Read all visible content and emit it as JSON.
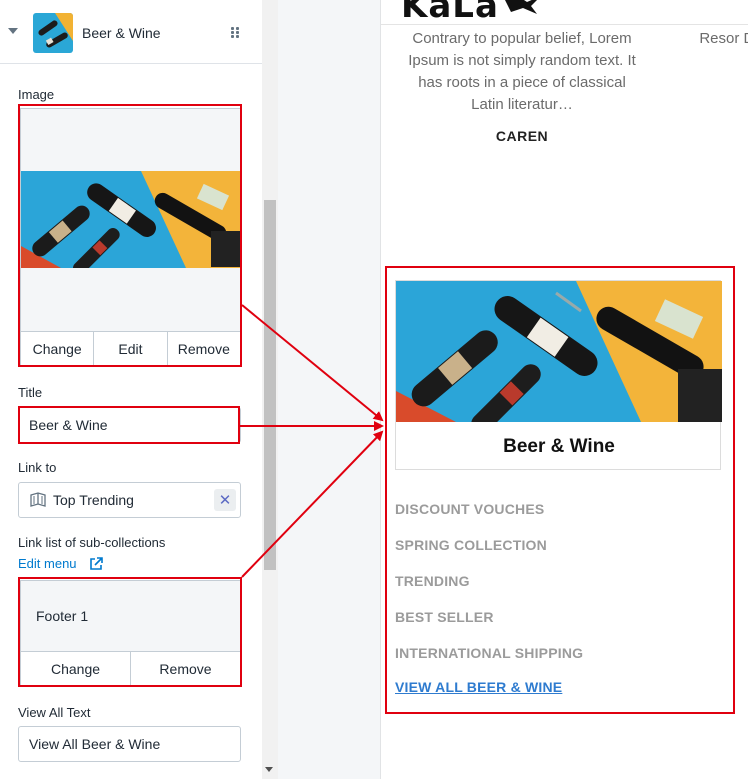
{
  "editor": {
    "block_title": "Beer & Wine",
    "image_label": "Image",
    "image_buttons": {
      "change": "Change",
      "edit": "Edit",
      "remove": "Remove"
    },
    "title_label": "Title",
    "title_value": "Beer & Wine",
    "link_label": "Link to",
    "link_value": "Top Trending",
    "link_clear": "✕",
    "sublist_label": "Link list of sub-collections",
    "edit_menu": "Edit menu",
    "menu_name": "Footer 1",
    "menu_buttons": {
      "change": "Change",
      "remove": "Remove"
    },
    "view_all_label": "View All Text",
    "view_all_value": "View All Beer & Wine"
  },
  "preview": {
    "logo_text": "KaLa",
    "testimonial": "Contrary to popular belief, Lorem Ipsum is not simply random text. It has roots in a piece of classical Latin literatur…",
    "testimonial_author": "CAREN",
    "testimonial_partial": "Resor Drizly dc price m",
    "card_title": "Beer & Wine",
    "sub_collections": [
      "DISCOUNT VOUCHES",
      "SPRING COLLECTION",
      "TRENDING",
      "BEST SELLER",
      "INTERNATIONAL SHIPPING"
    ],
    "view_all": "VIEW ALL BEER & WINE"
  },
  "colors": {
    "annotation": "#e0000f",
    "link_blue": "#007ace",
    "view_all_blue": "#2e7bcf"
  }
}
